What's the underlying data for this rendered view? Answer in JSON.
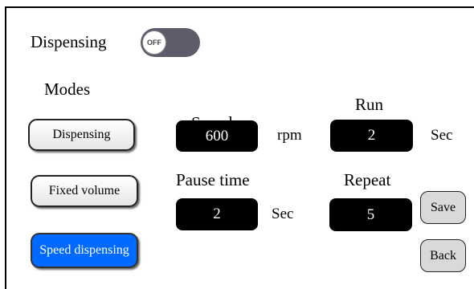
{
  "header": {
    "title": "Dispensing",
    "toggle_state": "OFF"
  },
  "modes": {
    "label": "Modes",
    "buttons": [
      {
        "label": "Dispensing",
        "selected": false
      },
      {
        "label": "Fixed volume",
        "selected": false
      },
      {
        "label": "Speed dispensing",
        "selected": true
      }
    ]
  },
  "fields": {
    "speed": {
      "label": "Speed",
      "value": "600",
      "unit": "rpm"
    },
    "run": {
      "label": "Run",
      "value": "2",
      "unit": "Sec"
    },
    "pause_time": {
      "label": "Pause time",
      "value": "2",
      "unit": "Sec"
    },
    "repeat": {
      "label": "Repeat",
      "value": "5"
    }
  },
  "actions": {
    "save_label": "Save",
    "back_label": "Back"
  },
  "colors": {
    "selected_mode": "#0069ff",
    "toggle_track": "#5d5c6b",
    "value_box": "#000000"
  }
}
